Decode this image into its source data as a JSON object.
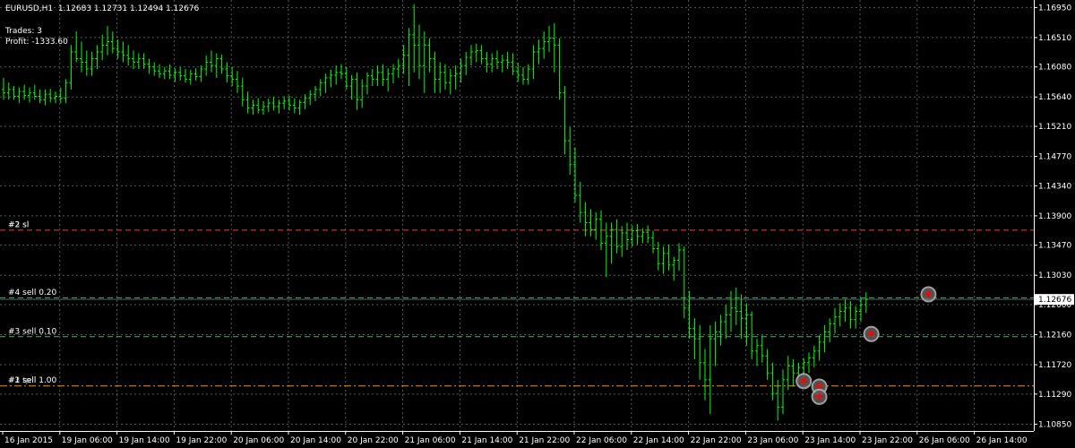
{
  "header": {
    "symbol_line": "EURUSD,H1  1.12683 1.12731 1.12494 1.12676",
    "trades": "Trades: 3",
    "profit": "Profit: -1333.60"
  },
  "colors": {
    "background": "#000000",
    "grid": "#9aa3aa",
    "candle": "#00ff00",
    "stop_line": "#ff3b3b",
    "entry_line": "#3cb371",
    "orange_line": "#ff8c00",
    "price_tag_bg": "#ffffff",
    "price_tag_text": "#000000",
    "marker_ring": "#b0b0b0",
    "marker_cross": "#ff0000"
  },
  "chart_data": {
    "type": "candlestick",
    "symbol": "EURUSD",
    "timeframe": "H1",
    "ylim": [
      1.1075,
      1.1706
    ],
    "y_ticks": [
      "1.16950",
      "1.16510",
      "1.16080",
      "1.15640",
      "1.15210",
      "1.14770",
      "1.14340",
      "1.13900",
      "1.13470",
      "1.13030",
      "1.12600",
      "1.12160",
      "1.11720",
      "1.11290",
      "1.10850"
    ],
    "x_ticks": [
      "16 Jan 2015",
      "19 Jan 06:00",
      "19 Jan 14:00",
      "19 Jan 22:00",
      "20 Jan 06:00",
      "20 Jan 14:00",
      "20 Jan 22:00",
      "21 Jan 06:00",
      "21 Jan 14:00",
      "21 Jan 22:00",
      "22 Jan 06:00",
      "22 Jan 14:00",
      "22 Jan 22:00",
      "23 Jan 06:00",
      "23 Jan 14:00",
      "23 Jan 22:00",
      "26 Jan 06:00",
      "26 Jan 14:00"
    ],
    "current_price": "1.12676",
    "bars": [
      [
        1.1575,
        1.1592,
        1.156,
        1.157
      ],
      [
        1.157,
        1.1585,
        1.156,
        1.1575
      ],
      [
        1.1575,
        1.158,
        1.156,
        1.1565
      ],
      [
        1.1565,
        1.1578,
        1.1555,
        1.1572
      ],
      [
        1.1572,
        1.1582,
        1.156,
        1.1566
      ],
      [
        1.1566,
        1.1578,
        1.1556,
        1.157
      ],
      [
        1.157,
        1.1582,
        1.156,
        1.1565
      ],
      [
        1.1565,
        1.1575,
        1.1555,
        1.156
      ],
      [
        1.156,
        1.1575,
        1.1552,
        1.1568
      ],
      [
        1.1568,
        1.1576,
        1.1556,
        1.1562
      ],
      [
        1.1562,
        1.1572,
        1.1555,
        1.1565
      ],
      [
        1.1565,
        1.1578,
        1.1555,
        1.1562
      ],
      [
        1.1562,
        1.159,
        1.1555,
        1.1585
      ],
      [
        1.1585,
        1.164,
        1.1575,
        1.163
      ],
      [
        1.163,
        1.166,
        1.1615,
        1.162
      ],
      [
        1.162,
        1.1645,
        1.16,
        1.1615
      ],
      [
        1.1615,
        1.1632,
        1.1595,
        1.1605
      ],
      [
        1.1605,
        1.163,
        1.1595,
        1.162
      ],
      [
        1.162,
        1.164,
        1.1605,
        1.163
      ],
      [
        1.163,
        1.1655,
        1.1618,
        1.164
      ],
      [
        1.164,
        1.1668,
        1.1625,
        1.1645
      ],
      [
        1.1645,
        1.166,
        1.1628,
        1.1635
      ],
      [
        1.1635,
        1.1648,
        1.162,
        1.163
      ],
      [
        1.163,
        1.1645,
        1.1615,
        1.1625
      ],
      [
        1.1625,
        1.164,
        1.161,
        1.162
      ],
      [
        1.162,
        1.1632,
        1.1605,
        1.1615
      ],
      [
        1.1615,
        1.1628,
        1.1605,
        1.162
      ],
      [
        1.162,
        1.1628,
        1.1605,
        1.1612
      ],
      [
        1.1612,
        1.162,
        1.1598,
        1.1608
      ],
      [
        1.1608,
        1.1615,
        1.1595,
        1.1602
      ],
      [
        1.1602,
        1.1612,
        1.1592,
        1.1598
      ],
      [
        1.1598,
        1.1608,
        1.159,
        1.1602
      ],
      [
        1.1602,
        1.1612,
        1.159,
        1.1596
      ],
      [
        1.1596,
        1.1606,
        1.1586,
        1.16
      ],
      [
        1.16,
        1.1608,
        1.1588,
        1.1595
      ],
      [
        1.1595,
        1.1605,
        1.1585,
        1.159
      ],
      [
        1.159,
        1.1604,
        1.1582,
        1.1598
      ],
      [
        1.1598,
        1.1606,
        1.1588,
        1.1594
      ],
      [
        1.1594,
        1.161,
        1.1586,
        1.1605
      ],
      [
        1.1605,
        1.1625,
        1.1595,
        1.1615
      ],
      [
        1.1615,
        1.1632,
        1.16,
        1.161
      ],
      [
        1.161,
        1.1628,
        1.1592,
        1.162
      ],
      [
        1.162,
        1.1626,
        1.1598,
        1.1605
      ],
      [
        1.1605,
        1.1615,
        1.1585,
        1.1595
      ],
      [
        1.1595,
        1.1608,
        1.158,
        1.159
      ],
      [
        1.159,
        1.1602,
        1.157,
        1.158
      ],
      [
        1.158,
        1.1592,
        1.155,
        1.156
      ],
      [
        1.156,
        1.1572,
        1.154,
        1.1548
      ],
      [
        1.1548,
        1.156,
        1.1538,
        1.1552
      ],
      [
        1.1552,
        1.1562,
        1.154,
        1.1545
      ],
      [
        1.1545,
        1.1558,
        1.1538,
        1.155
      ],
      [
        1.155,
        1.1562,
        1.1542,
        1.1555
      ],
      [
        1.1555,
        1.1564,
        1.1544,
        1.155
      ],
      [
        1.155,
        1.156,
        1.154,
        1.1555
      ],
      [
        1.1555,
        1.1565,
        1.1546,
        1.1558
      ],
      [
        1.1558,
        1.1566,
        1.1544,
        1.1552
      ],
      [
        1.1552,
        1.1562,
        1.154,
        1.1548
      ],
      [
        1.1548,
        1.156,
        1.1538,
        1.1556
      ],
      [
        1.1556,
        1.1568,
        1.1546,
        1.1562
      ],
      [
        1.1562,
        1.1574,
        1.1552,
        1.1568
      ],
      [
        1.1568,
        1.158,
        1.1558,
        1.1575
      ],
      [
        1.1575,
        1.159,
        1.1565,
        1.1585
      ],
      [
        1.1585,
        1.1598,
        1.157,
        1.1592
      ],
      [
        1.1592,
        1.1604,
        1.1578,
        1.1596
      ],
      [
        1.1596,
        1.161,
        1.1582,
        1.16
      ],
      [
        1.16,
        1.1612,
        1.159,
        1.1598
      ],
      [
        1.1598,
        1.1608,
        1.1575,
        1.158
      ],
      [
        1.158,
        1.1596,
        1.156,
        1.159
      ],
      [
        1.159,
        1.16,
        1.1545,
        1.156
      ],
      [
        1.156,
        1.159,
        1.1548,
        1.158
      ],
      [
        1.158,
        1.16,
        1.1568,
        1.1595
      ],
      [
        1.1595,
        1.1605,
        1.158,
        1.159
      ],
      [
        1.159,
        1.161,
        1.158,
        1.16
      ],
      [
        1.16,
        1.1612,
        1.158,
        1.159
      ],
      [
        1.159,
        1.1606,
        1.1572,
        1.1598
      ],
      [
        1.1598,
        1.1612,
        1.1584,
        1.1605
      ],
      [
        1.1605,
        1.162,
        1.1592,
        1.161
      ],
      [
        1.161,
        1.164,
        1.1598,
        1.1625
      ],
      [
        1.1625,
        1.1665,
        1.158,
        1.1655
      ],
      [
        1.1655,
        1.17,
        1.16,
        1.164
      ],
      [
        1.164,
        1.167,
        1.159,
        1.161
      ],
      [
        1.161,
        1.166,
        1.157,
        1.164
      ],
      [
        1.164,
        1.165,
        1.16,
        1.162
      ],
      [
        1.162,
        1.163,
        1.157,
        1.159
      ],
      [
        1.159,
        1.1615,
        1.157,
        1.16
      ],
      [
        1.16,
        1.1612,
        1.1575,
        1.1585
      ],
      [
        1.1585,
        1.1605,
        1.1568,
        1.1595
      ],
      [
        1.1595,
        1.161,
        1.1575,
        1.1598
      ],
      [
        1.1598,
        1.162,
        1.1585,
        1.161
      ],
      [
        1.161,
        1.163,
        1.1596,
        1.1622
      ],
      [
        1.1622,
        1.164,
        1.161,
        1.163
      ],
      [
        1.163,
        1.1642,
        1.1615,
        1.1632
      ],
      [
        1.1632,
        1.164,
        1.1612,
        1.162
      ],
      [
        1.162,
        1.163,
        1.16,
        1.1612
      ],
      [
        1.1612,
        1.1628,
        1.16,
        1.162
      ],
      [
        1.162,
        1.1632,
        1.1605,
        1.1615
      ],
      [
        1.1615,
        1.1626,
        1.16,
        1.1618
      ],
      [
        1.1618,
        1.163,
        1.1605,
        1.1615
      ],
      [
        1.1615,
        1.1628,
        1.1596,
        1.1602
      ],
      [
        1.1602,
        1.1614,
        1.1586,
        1.1596
      ],
      [
        1.1596,
        1.1608,
        1.1582,
        1.159
      ],
      [
        1.159,
        1.1612,
        1.1582,
        1.1605
      ],
      [
        1.1605,
        1.164,
        1.159,
        1.163
      ],
      [
        1.163,
        1.1648,
        1.1612,
        1.1635
      ],
      [
        1.1635,
        1.166,
        1.162,
        1.1645
      ],
      [
        1.1645,
        1.1668,
        1.163,
        1.165
      ],
      [
        1.165,
        1.1672,
        1.16,
        1.164
      ],
      [
        1.164,
        1.165,
        1.156,
        1.157
      ],
      [
        1.157,
        1.158,
        1.148,
        1.15
      ],
      [
        1.15,
        1.152,
        1.145,
        1.1465
      ],
      [
        1.1465,
        1.149,
        1.141,
        1.142
      ],
      [
        1.142,
        1.144,
        1.138,
        1.1395
      ],
      [
        1.1395,
        1.141,
        1.136,
        1.138
      ],
      [
        1.138,
        1.14,
        1.136,
        1.137
      ],
      [
        1.137,
        1.1395,
        1.1355,
        1.1385
      ],
      [
        1.1385,
        1.1398,
        1.134,
        1.135
      ],
      [
        1.135,
        1.138,
        1.13,
        1.136
      ],
      [
        1.136,
        1.138,
        1.132,
        1.137
      ],
      [
        1.137,
        1.1385,
        1.1335,
        1.1345
      ],
      [
        1.1345,
        1.1375,
        1.133,
        1.1365
      ],
      [
        1.1365,
        1.138,
        1.134,
        1.1355
      ],
      [
        1.1355,
        1.1376,
        1.1345,
        1.1368
      ],
      [
        1.1368,
        1.1378,
        1.1348,
        1.136
      ],
      [
        1.136,
        1.1372,
        1.135,
        1.1366
      ],
      [
        1.1366,
        1.1376,
        1.135,
        1.1358
      ],
      [
        1.1358,
        1.1368,
        1.1335,
        1.1342
      ],
      [
        1.1342,
        1.1352,
        1.131,
        1.132
      ],
      [
        1.132,
        1.1345,
        1.1305,
        1.1335
      ],
      [
        1.1335,
        1.1348,
        1.131,
        1.1318
      ],
      [
        1.1318,
        1.133,
        1.1295,
        1.1325
      ],
      [
        1.1325,
        1.135,
        1.131,
        1.134
      ],
      [
        1.134,
        1.1345,
        1.124,
        1.1255
      ],
      [
        1.1255,
        1.128,
        1.121,
        1.1225
      ],
      [
        1.1225,
        1.124,
        1.118,
        1.121
      ],
      [
        1.121,
        1.123,
        1.115,
        1.1175
      ],
      [
        1.1175,
        1.1195,
        1.112,
        1.115
      ],
      [
        1.115,
        1.123,
        1.11,
        1.121
      ],
      [
        1.121,
        1.1235,
        1.117,
        1.122
      ],
      [
        1.122,
        1.1245,
        1.12,
        1.1235
      ],
      [
        1.1235,
        1.126,
        1.121,
        1.1245
      ],
      [
        1.1245,
        1.128,
        1.122,
        1.1255
      ],
      [
        1.1255,
        1.1285,
        1.123,
        1.125
      ],
      [
        1.125,
        1.1275,
        1.121,
        1.124
      ],
      [
        1.124,
        1.1262,
        1.12,
        1.1245
      ],
      [
        1.1245,
        1.125,
        1.118,
        1.1192
      ],
      [
        1.1192,
        1.121,
        1.117,
        1.12
      ],
      [
        1.12,
        1.1215,
        1.1175,
        1.1185
      ],
      [
        1.1185,
        1.1195,
        1.115,
        1.116
      ],
      [
        1.116,
        1.1175,
        1.112,
        1.113
      ],
      [
        1.113,
        1.115,
        1.109,
        1.111
      ],
      [
        1.111,
        1.1165,
        1.11,
        1.115
      ],
      [
        1.115,
        1.1185,
        1.1135,
        1.117
      ],
      [
        1.117,
        1.118,
        1.114,
        1.116
      ],
      [
        1.116,
        1.1175,
        1.1145,
        1.1168
      ],
      [
        1.1168,
        1.1182,
        1.115,
        1.1175
      ],
      [
        1.1175,
        1.119,
        1.116,
        1.1182
      ],
      [
        1.1182,
        1.12,
        1.1168,
        1.1192
      ],
      [
        1.1192,
        1.1215,
        1.1178,
        1.1205
      ],
      [
        1.1205,
        1.123,
        1.119,
        1.122
      ],
      [
        1.122,
        1.124,
        1.1205,
        1.1232
      ],
      [
        1.1232,
        1.1255,
        1.1218,
        1.1242
      ],
      [
        1.1242,
        1.1262,
        1.1228,
        1.125
      ],
      [
        1.125,
        1.1268,
        1.1235,
        1.1255
      ],
      [
        1.1255,
        1.1265,
        1.1225,
        1.1238
      ],
      [
        1.1238,
        1.1258,
        1.1225,
        1.125
      ],
      [
        1.125,
        1.127,
        1.1235,
        1.126
      ],
      [
        1.126,
        1.1278,
        1.1248,
        1.1268
      ]
    ],
    "levels": [
      {
        "label": "#2 sl",
        "price": 1.1369,
        "color": "#ff3b3b",
        "style": "dash",
        "label_y": 1.13775
      },
      {
        "label": "#4 sell 0.20",
        "price": 1.127,
        "color": "#3cb371",
        "style": "dash",
        "label_y": 1.12785
      },
      {
        "label": "#3 sell 0.10",
        "price": 1.1213,
        "color": "#3cb371",
        "style": "dash",
        "label_y": 1.12215
      },
      {
        "label": "#1 sell 1.00",
        "price": 1.1141,
        "color": "#ff8c00",
        "style": "dashdot",
        "label_y": 1.11495
      }
    ],
    "level_ghost_labels": [
      {
        "text": "#3 sl",
        "price": 1.13775
      },
      {
        "text": "#2 sell",
        "price": 1.11495
      },
      {
        "text": "#3 tp",
        "price": 1.11495
      }
    ],
    "markers": [
      {
        "bar": 154,
        "price": 1.1148
      },
      {
        "bar": 157,
        "price": 1.114
      },
      {
        "bar": 157,
        "price": 1.1125
      },
      {
        "bar": 167,
        "price": 1.1217
      },
      {
        "bar": 178,
        "price": 1.1275
      }
    ]
  }
}
